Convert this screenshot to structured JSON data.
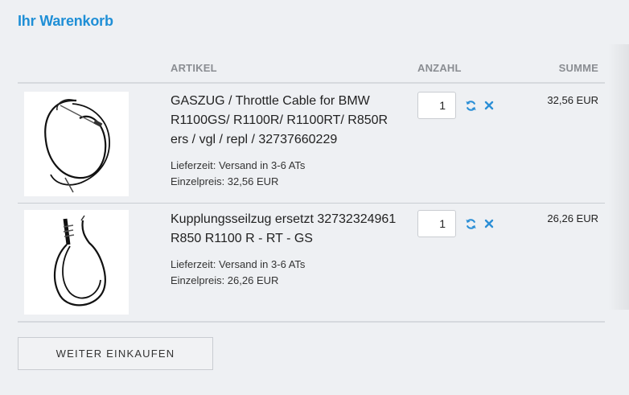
{
  "cart": {
    "title": "Ihr Warenkorb",
    "columns": {
      "article": "ARTIKEL",
      "quantity": "ANZAHL",
      "total": "SUMME"
    },
    "items": [
      {
        "name": "GASZUG / Throttle Cable for BMW R1100GS/ R1100R/ R1100RT/ R850R ers / vgl / repl / 32737660229",
        "delivery": "Lieferzeit: Versand in 3-6 ATs",
        "unit_price": "Einzelpreis: 32,56 EUR",
        "quantity": "1",
        "total": "32,56 EUR",
        "image_icon": "throttle-cable-image"
      },
      {
        "name": "Kupplungsseilzug ersetzt 32732324961 R850 R1100 R - RT - GS",
        "delivery": "Lieferzeit: Versand in 3-6 ATs",
        "unit_price": "Einzelpreis: 26,26 EUR",
        "quantity": "1",
        "total": "26,26 EUR",
        "image_icon": "clutch-cable-image"
      }
    ],
    "continue_label": "WEITER EINKAUFEN",
    "colors": {
      "accent": "#1f8fd6",
      "icon": "#2b8fd6"
    },
    "icons": {
      "refresh": "refresh-icon",
      "remove": "close-icon"
    }
  }
}
